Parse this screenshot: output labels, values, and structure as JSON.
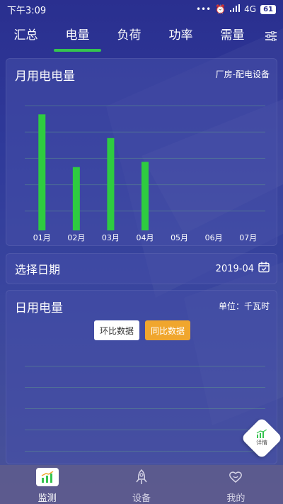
{
  "status": {
    "time": "下午3:09",
    "dots": "•••",
    "network": "4G",
    "battery": "61"
  },
  "tabs": [
    {
      "label": "汇总",
      "active": false
    },
    {
      "label": "电量",
      "active": true
    },
    {
      "label": "负荷",
      "active": false
    },
    {
      "label": "功率",
      "active": false
    },
    {
      "label": "需量",
      "active": false
    }
  ],
  "monthly": {
    "title": "月用电电量",
    "subtitle": "厂房-配电设备",
    "chart_data": {
      "type": "bar",
      "categories": [
        "01月",
        "02月",
        "03月",
        "04月",
        "05月",
        "06月",
        "07月"
      ],
      "values": [
        88,
        48,
        70,
        52,
        0,
        0,
        0
      ],
      "ylim": [
        0,
        100
      ],
      "grid": true,
      "bar_color": "#2ecc40"
    }
  },
  "date_picker": {
    "label": "选择日期",
    "value": "2019-04"
  },
  "daily": {
    "title": "日用电量",
    "unit": "单位：千瓦时",
    "btn_ring": "环比数据",
    "btn_yoy": "同比数据"
  },
  "fab": {
    "label": "详情"
  },
  "nav": [
    {
      "label": "监测",
      "active": true
    },
    {
      "label": "设备",
      "active": false
    },
    {
      "label": "我的",
      "active": false
    }
  ],
  "colors": {
    "accent_green": "#35c44f",
    "orange": "#f0a62e"
  }
}
